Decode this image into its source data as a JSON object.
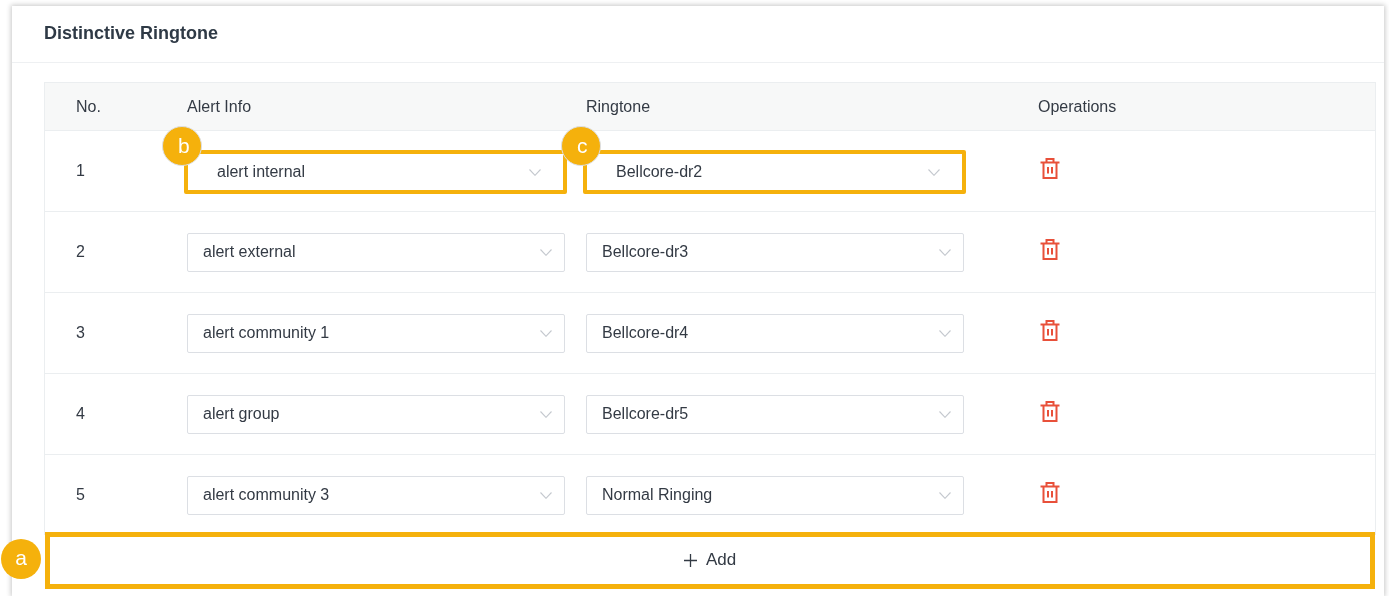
{
  "title": "Distinctive Ringtone",
  "table": {
    "columns": [
      "No.",
      "Alert Info",
      "Ringtone",
      "Operations"
    ],
    "rows": [
      {
        "no": "1",
        "alert_info": {
          "value": "alert internal",
          "callout": "b"
        },
        "ringtone": {
          "value": "Bellcore-dr2",
          "callout": "c"
        }
      },
      {
        "no": "2",
        "alert_info": {
          "value": "alert external"
        },
        "ringtone": {
          "value": "Bellcore-dr3"
        }
      },
      {
        "no": "3",
        "alert_info": {
          "value": "alert community 1"
        },
        "ringtone": {
          "value": "Bellcore-dr4"
        }
      },
      {
        "no": "4",
        "alert_info": {
          "value": "alert group"
        },
        "ringtone": {
          "value": "Bellcore-dr5"
        }
      },
      {
        "no": "5",
        "alert_info": {
          "value": "alert community 3"
        },
        "ringtone": {
          "value": "Normal Ringing"
        }
      }
    ]
  },
  "add_button": {
    "label": "Add",
    "callout": "a"
  }
}
